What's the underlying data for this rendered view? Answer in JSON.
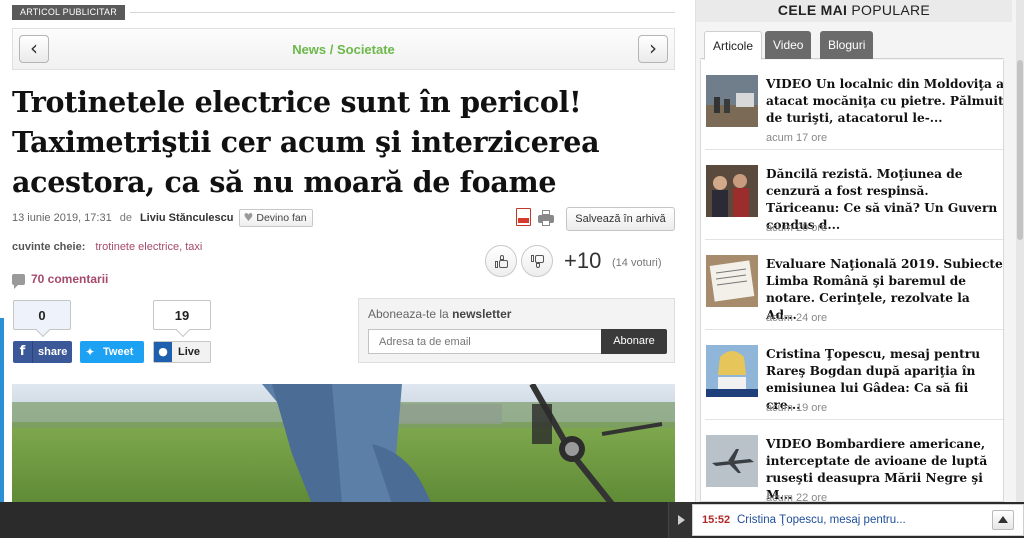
{
  "main": {
    "badge": "ARTICOL PUBLICITAR",
    "section_path": "News / Societate",
    "headline": "Trotinetele electrice sunt în pericol! Taximetriştii cer acum şi interzicerea acestora, ca să nu moară de foame",
    "date": "13 iunie 2019, 17:31",
    "de_label": "de",
    "author": "Liviu Stănculescu",
    "fan_button": "Devino fan",
    "save_button": "Salvează în arhivă",
    "keywords_label": "cuvinte cheie:",
    "keywords": "trotinete electrice, taxi",
    "score": "+10",
    "votes": "(14 voturi)",
    "comments": "70 comentarii",
    "share": {
      "facebook_count": "0",
      "facebook_label": "share",
      "twitter_label": "Tweet",
      "live_count": "19",
      "live_label": "Live"
    },
    "newsletter": {
      "title_prefix": "Aboneaza-te la",
      "title_bold": "newsletter",
      "placeholder": "Adresa ta de email",
      "button": "Abonare"
    }
  },
  "sidebar": {
    "title_bold": "CELE MAI",
    "title_rest": "POPULARE",
    "tabs": [
      "Articole",
      "Video",
      "Bloguri"
    ],
    "items": [
      {
        "title": "VIDEO Un localnic din Moldoviţa a atacat mocăniţa cu pietre. Pălmuit de turişti, atacatorul le-...",
        "time": "acum 17 ore"
      },
      {
        "title": "Dăncilă rezistă. Moţiunea de cenzură a fost respinsă. Tăriceanu: Ce să vină? Un Guvern condus d...",
        "time": "acum 20 ore"
      },
      {
        "title": "Evaluare Naţională 2019. Subiecte Limba Română şi baremul de notare. Cerinţele, rezolvate la Ad...",
        "time": "acum 24 ore"
      },
      {
        "title": "Cristina Ţopescu, mesaj pentru Rareş Bogdan după apariţia în emisiunea lui Gâdea: Ca să fii cre...",
        "time": "acum 19 ore"
      },
      {
        "title": "VIDEO Bombardiere americane, interceptate de avioane de luptă ruseşti deasupra Mării Negre şi M...",
        "time": "acum 22 ore"
      }
    ]
  },
  "ticker": {
    "time": "15:52",
    "text": "Cristina Ţopescu, mesaj pentru..."
  },
  "colors": {
    "section_green": "#6cb84a",
    "keyword_pink": "#a54a6c",
    "facebook": "#3b5998",
    "twitter": "#1da1f2"
  }
}
